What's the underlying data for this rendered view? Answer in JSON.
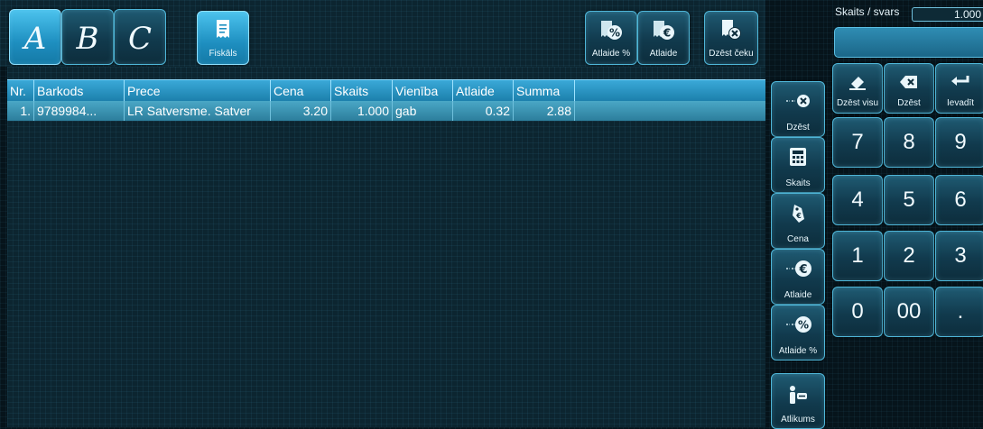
{
  "tabs": {
    "a": "A",
    "b": "B",
    "c": "C"
  },
  "toolbar": {
    "fiskals": "Fiskāls",
    "atlaide_pct": "Atlaide %",
    "atlaide": "Atlaide",
    "dzest_ceku": "Dzēst čeku"
  },
  "table": {
    "headers": [
      "Nr.",
      "Barkods",
      "Prece",
      "Cena",
      "Skaits",
      "Vienība",
      "Atlaide",
      "Summa"
    ],
    "rows": [
      {
        "nr": "1.",
        "barkods": "9789984...",
        "prece": "LR Satversme. Satver",
        "cena": "3.20",
        "skaits": "1.000",
        "vieniba": "gab",
        "atlaide": "0.32",
        "summa": "2.88"
      }
    ]
  },
  "side_actions": {
    "dzest": "Dzēst",
    "skaits": "Skaits",
    "cena": "Cena",
    "atlaide": "Atlaide",
    "atlaide_pct": "Atlaide %",
    "atlikums": "Atlikums"
  },
  "keypad": {
    "header_label": "Skaits / svars",
    "header_value": "1.000",
    "clear_all": "Dzēst visu",
    "delete": "Dzēst",
    "enter": "Ievadīt",
    "digits": [
      "7",
      "8",
      "9",
      "4",
      "5",
      "6",
      "1",
      "2",
      "3",
      "0",
      "00",
      "."
    ]
  },
  "icons": {
    "receipt": "receipt-icon",
    "discount_percent": "discount-percent-icon",
    "discount_euro": "discount-euro-icon",
    "delete_receipt": "delete-receipt-icon",
    "delete_row": "delete-row-icon",
    "calculator": "calculator-icon",
    "price_tag": "price-tag-icon",
    "euro_coin": "euro-coin-icon",
    "percent_coin": "percent-coin-icon",
    "change": "change-icon",
    "eraser": "eraser-icon",
    "backspace": "backspace-icon",
    "enter": "enter-icon"
  },
  "colors": {
    "accent": "#3aa9d8",
    "background": "#0c2530",
    "button": "#1f5a72"
  }
}
